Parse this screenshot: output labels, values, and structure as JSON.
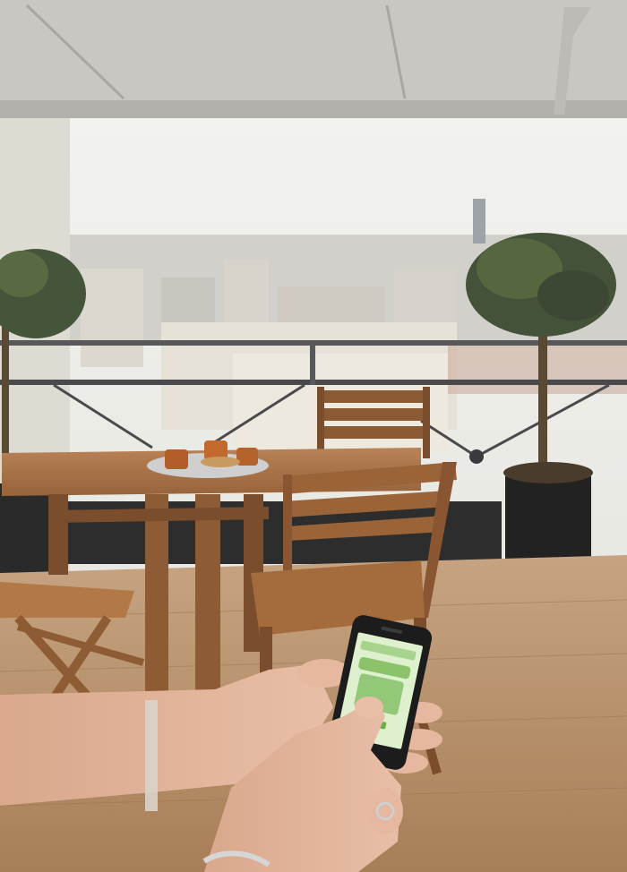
{
  "scene": {
    "subject": "rooftop-terrace",
    "colors": {
      "sky": "#ecece8",
      "awning": "#c9c7c2",
      "deck": "#b58f6a",
      "table": "#a06a3d",
      "skin": "#e2b49b",
      "screen": "#dff0cf",
      "screen_accent": "#8cc26a",
      "phone": "#1c1c1c",
      "planter": "#252525",
      "foliage": "#4c5a3c"
    }
  }
}
